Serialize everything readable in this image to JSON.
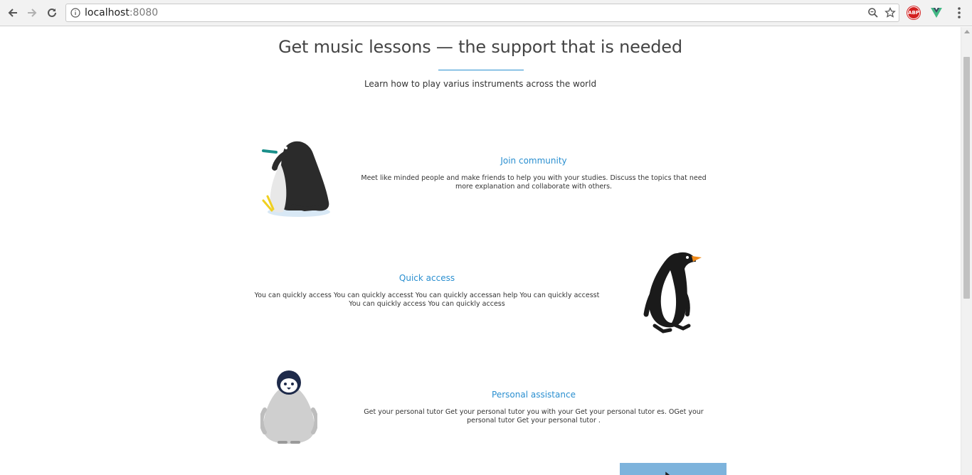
{
  "browser": {
    "url_host": "localhost",
    "url_port": ":8080",
    "icons": [
      "back-icon",
      "forward-icon",
      "reload-icon",
      "info-icon",
      "zoom-icon",
      "star-icon",
      "adblock-icon",
      "vue-devtools-icon",
      "menu-icon"
    ],
    "adblock_label": "ABP"
  },
  "hero": {
    "title": "Get music lessons — the support that is needed",
    "subtitle": "Learn how to play varius instruments across the world"
  },
  "features": [
    {
      "title": "Join community",
      "text": "Meet like minded people and make friends to help you with your studies. Discuss the topics that need more explanation and collaborate with others."
    },
    {
      "title": "Quick access",
      "text": "You can quickly access You can quickly accesst You can quickly accessan help You can quickly accesst You can quickly access You can quickly access"
    },
    {
      "title": "Personal assistance",
      "text": "Get your personal tutor Get your personal tutor you with your Get your personal tutor es. OGet your personal tutor Get your personal tutor ."
    }
  ],
  "colors": {
    "accent": "#2a8fd0",
    "text": "#333333",
    "heading": "#444444"
  }
}
